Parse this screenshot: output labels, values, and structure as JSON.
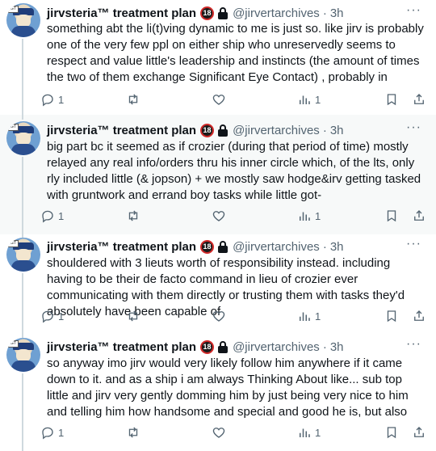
{
  "tweets": [
    {
      "name": "jirvsteria™ treatment plan",
      "age_badge": "18",
      "handle": "@jirvertarchives",
      "time": "3h",
      "text": "something abt the li(t)ving dynamic to me is just so. like jirv is probably one of the very few ppl on either ship who unreservedly seems to respect and value little's leadership and instincts (the amount of times the two of them exchange Significant Eye Contact) , probably in",
      "replies": "1",
      "views": "1"
    },
    {
      "name": "jirvsteria™ treatment plan",
      "age_badge": "18",
      "handle": "@jirvertarchives",
      "time": "3h",
      "text": "big part bc it seemed as if crozier (during that period of time) mostly relayed any real info/orders thru his inner circle which, of the lts, only rly included little (& jopson) + we mostly saw hodge&irv getting tasked with gruntwork and errand boy tasks while little got-",
      "replies": "1",
      "views": "1"
    },
    {
      "name": "jirvsteria™ treatment plan",
      "age_badge": "18",
      "handle": "@jirvertarchives",
      "time": "3h",
      "text": "shouldered with 3 lieuts worth of responsibility instead. including having to be their de facto command in lieu of crozier ever communicating with them directly or trusting them with tasks they'd absolutely have been capable of",
      "replies": "1",
      "views": "1"
    },
    {
      "name": "jirvsteria™ treatment plan",
      "age_badge": "18",
      "handle": "@jirvertarchives",
      "time": "3h",
      "text": "so anyway imo jirv would very likely follow him anywhere if it came down to it. and as a ship i am always Thinking About like... sub top little and jirv very gently domming him by just being very nice to him and telling him how handsome and special and good he is, but also",
      "replies": "1",
      "views": "1"
    }
  ],
  "icons": {
    "more": "more-dots-icon",
    "reply": "reply-icon",
    "retweet": "retweet-icon",
    "like": "heart-icon",
    "views": "views-icon",
    "bookmark": "bookmark-icon",
    "share": "share-icon"
  },
  "colors": {
    "text": "#0f1419",
    "muted": "#536471",
    "thread_line": "#cfd9de",
    "highlight_bg": "#f7f9f9"
  }
}
